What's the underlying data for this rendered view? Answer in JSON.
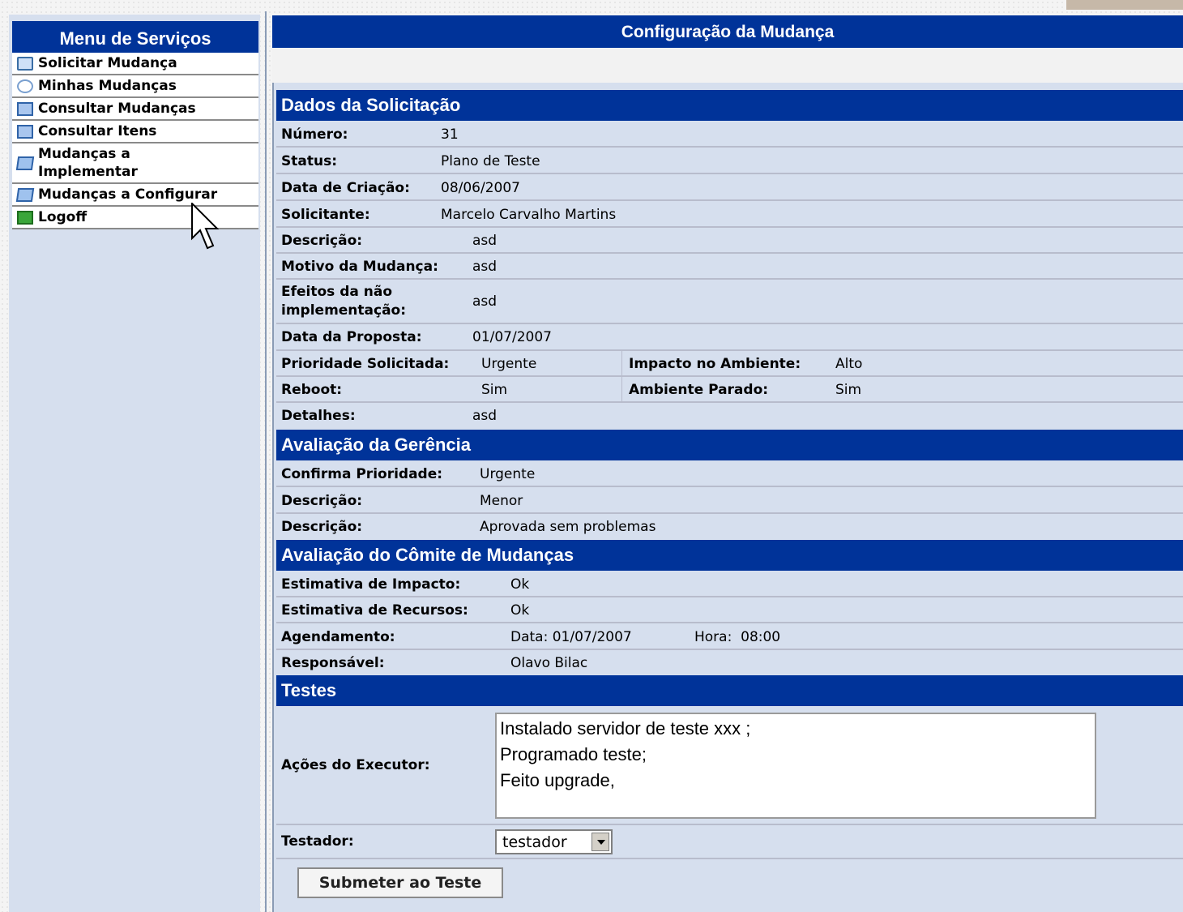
{
  "menu": {
    "title": "Menu de Serviços",
    "items": [
      {
        "label": "Solicitar Mudança",
        "icon": "folder-icon"
      },
      {
        "label": "Minhas Mudanças",
        "icon": "search-icon"
      },
      {
        "label": "Consultar Mudanças",
        "icon": "screen-icon"
      },
      {
        "label": "Consultar Itens",
        "icon": "screen-icon"
      },
      {
        "label": "Mudanças a Implementar",
        "icon": "edit-icon"
      },
      {
        "label": "Mudanças a Configurar",
        "icon": "edit-icon"
      },
      {
        "label": "Logoff",
        "icon": "exit-icon"
      }
    ]
  },
  "page_title": "Configuração da Mudança",
  "dados": {
    "title": "Dados da Solicitação",
    "numero_label": "Número:",
    "numero": "31",
    "status_label": "Status:",
    "status": "Plano de Teste",
    "data_criacao_label": "Data de Criação:",
    "data_criacao": "08/06/2007",
    "solicitante_label": "Solicitante:",
    "solicitante": "Marcelo Carvalho Martins",
    "descricao_label": "Descrição:",
    "descricao": "asd",
    "motivo_label": "Motivo da Mudança:",
    "motivo": "asd",
    "efeitos_label_1": "Efeitos da não",
    "efeitos_label_2": "implementação:",
    "efeitos": "asd",
    "data_proposta_label": "Data da Proposta:",
    "data_proposta": "01/07/2007",
    "prioridade_label": "Prioridade Solicitada:",
    "prioridade": "Urgente",
    "impacto_label": "Impacto no Ambiente:",
    "impacto": "Alto",
    "reboot_label": "Reboot:",
    "reboot": "Sim",
    "parado_label": "Ambiente Parado:",
    "parado": "Sim",
    "detalhes_label": "Detalhes:",
    "detalhes": "asd"
  },
  "gerencia": {
    "title": "Avaliação da Gerência",
    "confirma_label": "Confirma Prioridade:",
    "confirma": "Urgente",
    "descricao1_label": "Descrição:",
    "descricao1": "Menor",
    "descricao2_label": "Descrição:",
    "descricao2": "Aprovada sem problemas"
  },
  "comite": {
    "title": "Avaliação do Cômite de Mudanças",
    "impacto_label": "Estimativa de Impacto:",
    "impacto": "Ok",
    "recursos_label": "Estimativa de Recursos:",
    "recursos": "Ok",
    "agendamento_label": "Agendamento:",
    "data_text": "Data: 01/07/2007",
    "hora_text": "Hora:  08:00",
    "responsavel_label": "Responsável:",
    "responsavel": "Olavo Bilac"
  },
  "testes": {
    "title": "Testes",
    "acoes_label": "Ações do Executor:",
    "acoes_value": "Instalado servidor de teste xxx ;\nProgramado teste;\nFeito upgrade,",
    "testador_label": "Testador:",
    "testador_selected": "testador",
    "submit_label": "Submeter ao Teste"
  }
}
